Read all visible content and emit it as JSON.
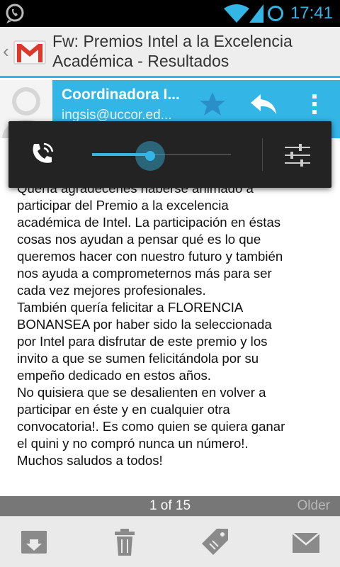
{
  "status_bar": {
    "time": "17:41",
    "icons": [
      "whatsapp-icon",
      "wifi-icon",
      "signal-icon",
      "sync-ring-icon"
    ],
    "accent_color": "#33b5e5"
  },
  "action_bar": {
    "subject_line1": "Fw: Premios Intel a la Excelencia",
    "subject_line2": "Académica - Resultados",
    "icons": [
      "back-chevron-icon",
      "gmail-icon"
    ]
  },
  "sender": {
    "name": "Coordinadora I...",
    "email": "ingsis@uccor.ed...",
    "icons": [
      "avatar-icon",
      "star-icon",
      "reply-icon",
      "overflow-menu-icon"
    ]
  },
  "body": {
    "lines": [
      "Quería agradecerles haberse animado a",
      "participar del Premio a la excelencia",
      "académica de Intel. La participación en éstas",
      "cosas nos ayudan a pensar qué es lo que",
      "queremos hacer con nuestro futuro y también",
      "nos ayuda a comprometernos más para ser",
      "cada vez mejores profesionales.",
      "También quería felicitar a FLORENCIA",
      "BONANSEA por haber sido la seleccionada",
      "por Intel para disfrutar de este premio y los",
      "invito a que se sumen felicitándola por su",
      "empeño dedicado en estos años.",
      "No quisiera que se desalienten en volver a",
      "participar en éste y en cualquier otra",
      "convocatoria!. Es como quien se quiera ganar",
      "el quini y no compró nunca un número!.",
      "Muchos saludos a todos!"
    ]
  },
  "volume_overlay": {
    "level": 0.42,
    "icons": [
      "phone-call-icon",
      "settings-sliders-icon"
    ]
  },
  "pagination": {
    "count_text": "1 of 15",
    "older_label": "Older"
  },
  "bottom_bar": {
    "icons": [
      "archive-icon",
      "delete-icon",
      "label-icon",
      "mark-unread-icon"
    ]
  }
}
